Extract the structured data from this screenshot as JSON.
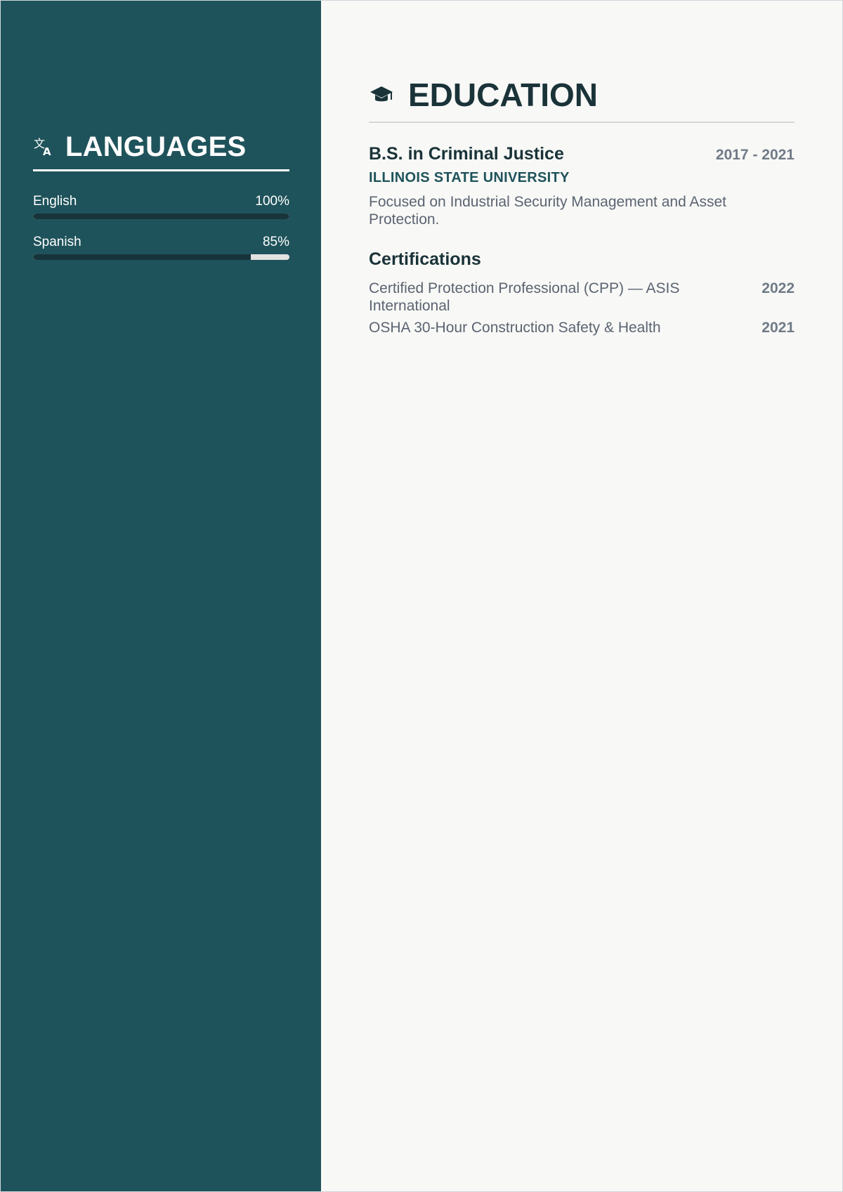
{
  "sidebar": {
    "languages": {
      "title": "LANGUAGES",
      "icon": "translate-icon",
      "items": [
        {
          "name": "English",
          "level": "100%",
          "fraction": 1.0
        },
        {
          "name": "Spanish",
          "level": "85%",
          "fraction": 0.85
        }
      ]
    }
  },
  "main": {
    "education": {
      "title": "EDUCATION",
      "icon": "graduation-cap-icon",
      "degree": "B.S. in Criminal Justice",
      "years": "2017 - 2021",
      "school": "ILLINOIS STATE UNIVERSITY",
      "description": "Focused on Industrial Security Management and Asset Protection."
    },
    "certifications": {
      "title": "Certifications",
      "items": [
        {
          "name": "Certified Protection Professional (CPP) — ASIS International",
          "year": "2022"
        },
        {
          "name": "OSHA 30-Hour Construction Safety & Health",
          "year": "2021"
        }
      ]
    }
  },
  "colors": {
    "sidebar_bg": "#1f535b",
    "bar_fill": "#17343a",
    "bar_track": "#e3e3e1",
    "accent": "#1f535b",
    "main_bg": "#f8f8f6"
  }
}
